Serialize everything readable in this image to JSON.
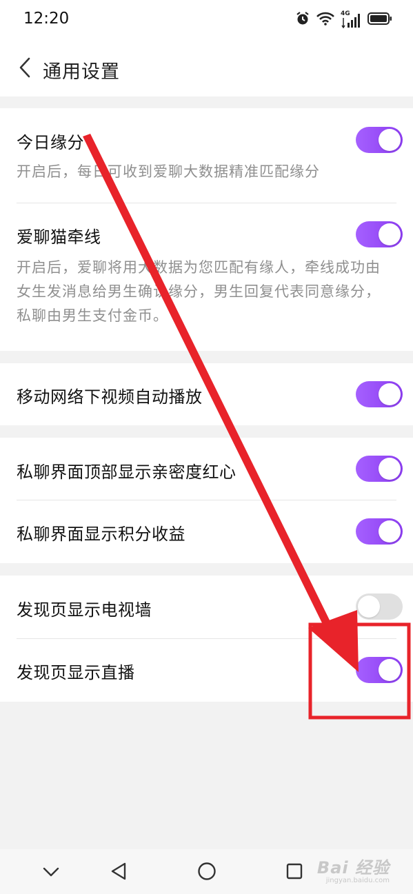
{
  "status_bar": {
    "time": "12:20",
    "network_label": "4G",
    "icons": [
      "alarm-icon",
      "wifi-icon",
      "cellular-signal-icon",
      "battery-icon"
    ]
  },
  "header": {
    "title": "通用设置",
    "back_icon": "chevron-left-icon"
  },
  "settings": {
    "fate": {
      "label": "今日缘分",
      "description": "开启后，每日可收到爱聊大数据精准匹配缘分",
      "enabled": true
    },
    "matchmaker": {
      "label": "爱聊猫牵线",
      "description": "开启后，爱聊将用大数据为您匹配有缘人，牵线成功由女生发消息给男生确认缘分，男生回复代表同意缘分，私聊由男生支付金币。",
      "enabled": true
    },
    "autoplay": {
      "label": "移动网络下视频自动播放",
      "enabled": true
    },
    "intimacy_heart": {
      "label": "私聊界面顶部显示亲密度红心",
      "enabled": true
    },
    "points_income": {
      "label": "私聊界面显示积分收益",
      "enabled": true
    },
    "tv_wall": {
      "label": "发现页显示电视墙",
      "enabled": false
    },
    "live": {
      "label": "发现页显示直播",
      "enabled": true
    }
  },
  "colors": {
    "toggle_on": "#9b4ff5",
    "toggle_off": "#e0e0e0",
    "annotation_red": "#e8232a",
    "background": "#f2f2f2"
  },
  "bottom_nav": {
    "icons": [
      "chevron-down-icon",
      "back-triangle-icon",
      "home-circle-icon",
      "recents-square-icon"
    ]
  },
  "watermark": {
    "main": "Bai 经验",
    "sub": "jingyan.baidu.com"
  }
}
